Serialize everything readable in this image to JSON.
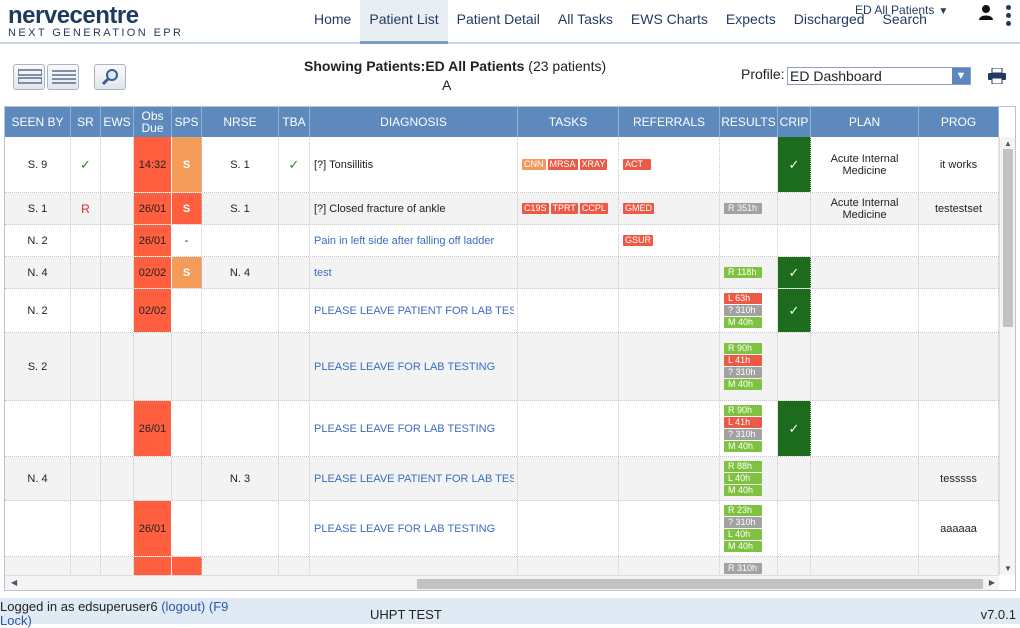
{
  "app": {
    "logo_main": "nervecentre",
    "logo_sub": "NEXT GENERATION EPR"
  },
  "nav": {
    "items": [
      {
        "label": "Home",
        "active": false
      },
      {
        "label": "Patient List",
        "active": true
      },
      {
        "label": "Patient Detail",
        "active": false
      },
      {
        "label": "All Tasks",
        "active": false
      },
      {
        "label": "EWS Charts",
        "active": false
      },
      {
        "label": "Expects",
        "active": false
      },
      {
        "label": "Discharged",
        "active": false
      },
      {
        "label": "Search",
        "active": false
      }
    ],
    "view_selector": "ED All Patients"
  },
  "toolbar": {
    "showing_prefix": "Showing Patients:",
    "showing_list": "ED All Patients",
    "showing_count": "(23 patients)",
    "sub_letter": "A",
    "profile_label": "Profile:",
    "profile_value": "ED Dashboard"
  },
  "columns": [
    "SEEN BY",
    "SR",
    "EWS",
    "Obs Due",
    "SPS",
    "NRSE",
    "TBA",
    "DIAGNOSIS",
    "TASKS",
    "REFERRALS",
    "RESULTS",
    "CRIP",
    "PLAN",
    "PROG"
  ],
  "rows": [
    {
      "seen": "S. 9",
      "sr": "✓",
      "obs": "14:32",
      "sps": "S",
      "nrse": "S. 1",
      "tba": "✓",
      "diag": "[?] Tonsillitis",
      "diag_link": false,
      "tasks": [
        "CNN",
        "MRSA",
        "XRAY"
      ],
      "refs": [
        "ACT"
      ],
      "results": [],
      "crip": "✓",
      "plan": "Acute Internal Medicine",
      "prog": "it works"
    },
    {
      "seen": "S. 1",
      "sr": "R",
      "obs": "26/01",
      "sps": "S",
      "nrse": "S. 1",
      "tba": "",
      "diag": "[?] Closed fracture of ankle",
      "diag_link": false,
      "tasks": [
        "C19S",
        "TPRT",
        "CCPL"
      ],
      "refs": [
        "GMED"
      ],
      "results": [
        "R 351h"
      ],
      "crip": "",
      "plan": "Acute Internal Medicine",
      "prog": "testestset"
    },
    {
      "seen": "N. 2",
      "sr": "",
      "obs": "26/01",
      "sps": "-",
      "nrse": "",
      "tba": "",
      "diag": "Pain in left side after falling off ladder",
      "diag_link": true,
      "tasks": [],
      "refs": [
        "GSUR"
      ],
      "results": [],
      "crip": "",
      "plan": "",
      "prog": ""
    },
    {
      "seen": "N. 4",
      "sr": "",
      "obs": "02/02",
      "sps": "S",
      "nrse": "N. 4",
      "tba": "",
      "diag": "test",
      "diag_link": true,
      "tasks": [],
      "refs": [],
      "results": [
        "R 118h"
      ],
      "crip": "✓",
      "plan": "",
      "prog": ""
    },
    {
      "seen": "N. 2",
      "sr": "",
      "obs": "02/02",
      "sps": "",
      "nrse": "",
      "tba": "",
      "diag": "PLEASE LEAVE PATIENT FOR LAB TESTING",
      "diag_link": true,
      "tasks": [],
      "refs": [],
      "results": [
        "L 63h",
        "? 310h",
        "M 40h"
      ],
      "crip": "✓",
      "plan": "",
      "prog": ""
    },
    {
      "seen": "S. 2",
      "sr": "",
      "obs": "",
      "sps": "",
      "nrse": "",
      "tba": "",
      "diag": "PLEASE LEAVE FOR LAB TESTING",
      "diag_link": true,
      "tasks": [],
      "refs": [],
      "results": [
        "R 90h",
        "L 41h",
        "? 310h",
        "M 40h"
      ],
      "crip": "",
      "plan": "",
      "prog": ""
    },
    {
      "seen": "",
      "sr": "",
      "obs": "26/01",
      "sps": "",
      "nrse": "",
      "tba": "",
      "diag": "PLEASE LEAVE FOR LAB TESTING",
      "diag_link": true,
      "tasks": [],
      "refs": [],
      "results": [
        "R 90h",
        "L 41h",
        "? 310h",
        "M 40h"
      ],
      "crip": "✓",
      "plan": "",
      "prog": ""
    },
    {
      "seen": "N. 4",
      "sr": "",
      "obs": "",
      "sps": "",
      "nrse": "N. 3",
      "tba": "",
      "diag": "PLEASE LEAVE PATIENT FOR LAB TESTING",
      "diag_link": true,
      "tasks": [],
      "refs": [],
      "results": [
        "R 88h",
        "L 40h",
        "M 40h"
      ],
      "crip": "",
      "plan": "",
      "prog": "tesssss"
    },
    {
      "seen": "",
      "sr": "",
      "obs": "26/01",
      "sps": "",
      "nrse": "",
      "tba": "",
      "diag": "PLEASE LEAVE FOR LAB TESTING",
      "diag_link": true,
      "tasks": [],
      "refs": [],
      "results": [
        "R 23h",
        "? 310h",
        "L 40h",
        "M 40h"
      ],
      "crip": "",
      "plan": "",
      "prog": "aaaaaa"
    },
    {
      "seen": "",
      "sr": "",
      "obs": "",
      "sps": "",
      "nrse": "",
      "tba": "",
      "diag": "",
      "diag_link": true,
      "tasks": [],
      "refs": [],
      "results": [
        "R 310h"
      ],
      "crip": "",
      "plan": "",
      "prog": ""
    }
  ],
  "footer": {
    "logged_in": "Logged in as edsuperuser6",
    "logout": "(logout)",
    "lock": "(F9 Lock)",
    "site": "UHPT TEST",
    "version": "v7.0.1"
  },
  "colors": {
    "header_blue": "#5e89bd",
    "obs_red": "#ff5f3f",
    "sps_orange": "#f39c5a",
    "crip_green": "#1d6b1d",
    "result_green": "#7fc241",
    "result_red": "#ec5a45",
    "result_grey": "#a2a2a2"
  },
  "icons": [
    "list-view-icon",
    "magnify-icon",
    "user-icon",
    "kebab-menu-icon",
    "printer-icon",
    "dropdown-arrow-icon"
  ]
}
